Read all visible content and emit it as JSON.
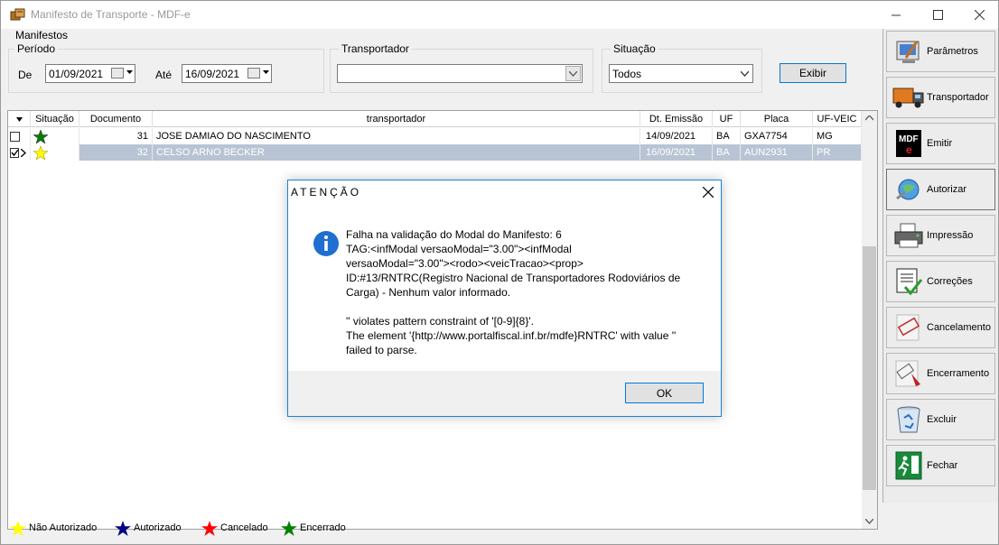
{
  "window": {
    "title": "Manifesto de Transporte - MDF-e"
  },
  "filters": {
    "section_label": "Manifestos",
    "period_label": "Período",
    "from_label": "De",
    "from_value": "01/09/2021",
    "to_label": "Até",
    "to_value": "16/09/2021",
    "carrier_label": "Transportador",
    "carrier_value": "",
    "status_label": "Situação",
    "status_value": "Todos",
    "show_button": "Exibir"
  },
  "grid": {
    "columns": [
      "",
      "Situação",
      "Documento",
      "transportador",
      "Dt. Emissão",
      "UF",
      "Placa",
      "UF-VEIC"
    ],
    "rows": [
      {
        "status_color": "#008000",
        "document": "31",
        "carrier": "JOSE DAMIAO DO NASCIMENTO",
        "date": "14/09/2021",
        "uf": "BA",
        "plate": "GXA7754",
        "uf_veic": "MG",
        "checked": false,
        "selected": false
      },
      {
        "status_color": "#ffff00",
        "document": "32",
        "carrier": "CELSO ARNO BECKER",
        "date": "16/09/2021",
        "uf": "BA",
        "plate": "AUN2931",
        "uf_veic": "PR",
        "checked": true,
        "selected": true
      }
    ]
  },
  "legend": [
    {
      "label": "Não Autorizado",
      "color": "#ffff00"
    },
    {
      "label": "Autorizado",
      "color": "#000080"
    },
    {
      "label": "Cancelado",
      "color": "#ff0000"
    },
    {
      "label": "Encerrado",
      "color": "#008000"
    }
  ],
  "sidebar": {
    "items": [
      {
        "label": "Parâmetros",
        "icon": "parameters-icon"
      },
      {
        "label": "Transportador",
        "icon": "truck-icon"
      },
      {
        "label": "Emitir",
        "icon": "mdfe-icon"
      },
      {
        "label": "Autorizar",
        "icon": "authorize-globe-icon"
      },
      {
        "label": "Impressão",
        "icon": "printer-icon"
      },
      {
        "label": "Correções",
        "icon": "corrections-icon"
      },
      {
        "label": "Cancelamento",
        "icon": "cancel-stamp-icon"
      },
      {
        "label": "Encerramento",
        "icon": "close-stamp-icon"
      },
      {
        "label": "Excluir",
        "icon": "recycle-bin-icon"
      },
      {
        "label": "Fechar",
        "icon": "exit-icon"
      }
    ]
  },
  "dialog": {
    "title": "ATENÇÃO",
    "message": "Falha na validação do Modal do Manifesto: 6\nTAG:<infModal versaoModal=\"3.00\"><infModal\nversaoModal=\"3.00\"><rodo><veicTracao><prop>\nID:#13/RNTRC(Registro Nacional de Transportadores Rodoviários de\nCarga) - Nenhum valor informado.\n\n'' violates pattern constraint of '[0-9]{8}'.\nThe element '{http://www.portalfiscal.inf.br/mdfe}RNTRC' with value ''\nfailed to parse.",
    "ok_label": "OK"
  }
}
